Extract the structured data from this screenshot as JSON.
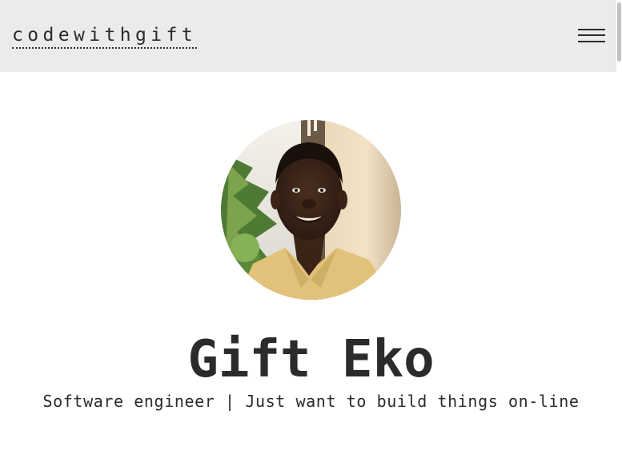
{
  "header": {
    "brand": "codewithgift",
    "menu_icon": "hamburger-menu-icon"
  },
  "profile": {
    "avatar_icon": "profile-photo",
    "name": "Gift Eko",
    "tagline": "Software engineer | Just want to build things on-line"
  },
  "colors": {
    "header_bg": "#ebebeb",
    "text": "#2b2b2b",
    "background": "#ffffff"
  }
}
